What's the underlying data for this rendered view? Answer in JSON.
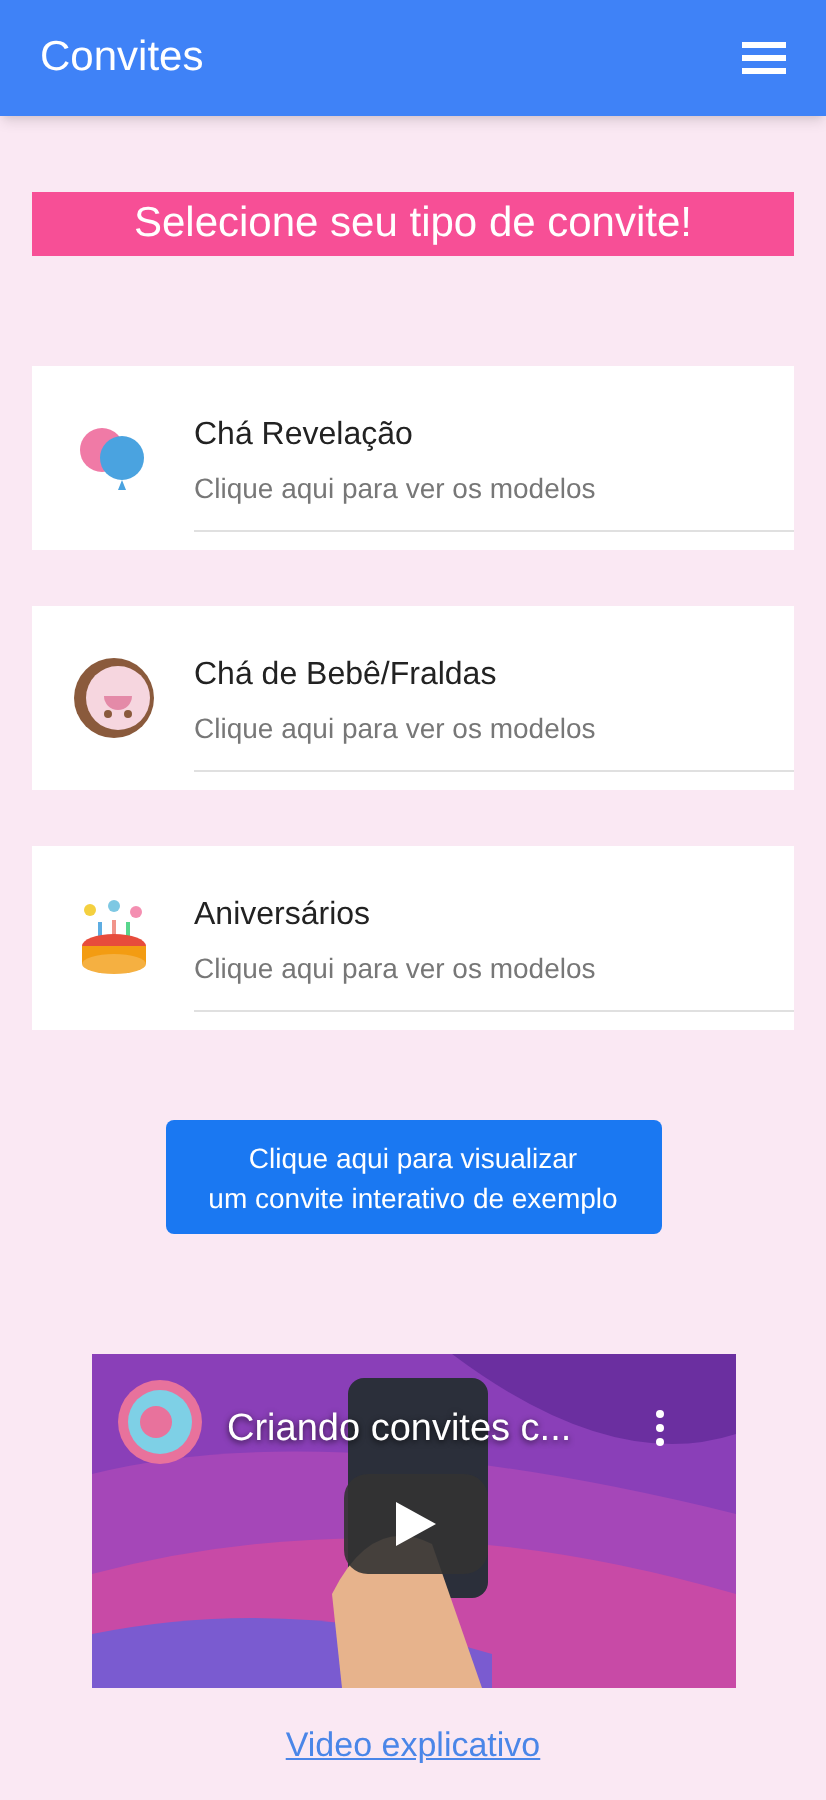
{
  "app_bar": {
    "title": "Convites"
  },
  "banner": "Selecione seu tipo de convite!",
  "categories": [
    {
      "kind": "balloons",
      "title": "Chá Revelação",
      "subtitle": "Clique aqui para ver os modelos"
    },
    {
      "kind": "baby",
      "title": "Chá de Bebê/Fraldas",
      "subtitle": "Clique aqui para ver os modelos"
    },
    {
      "kind": "cake",
      "title": "Aniversários",
      "subtitle": "Clique aqui para ver os modelos"
    }
  ],
  "example_button": [
    "Clique aqui para visualizar",
    "um convite interativo de exemplo"
  ],
  "video": {
    "title": "Criando convites c..."
  },
  "video_link": "Video explicativo"
}
